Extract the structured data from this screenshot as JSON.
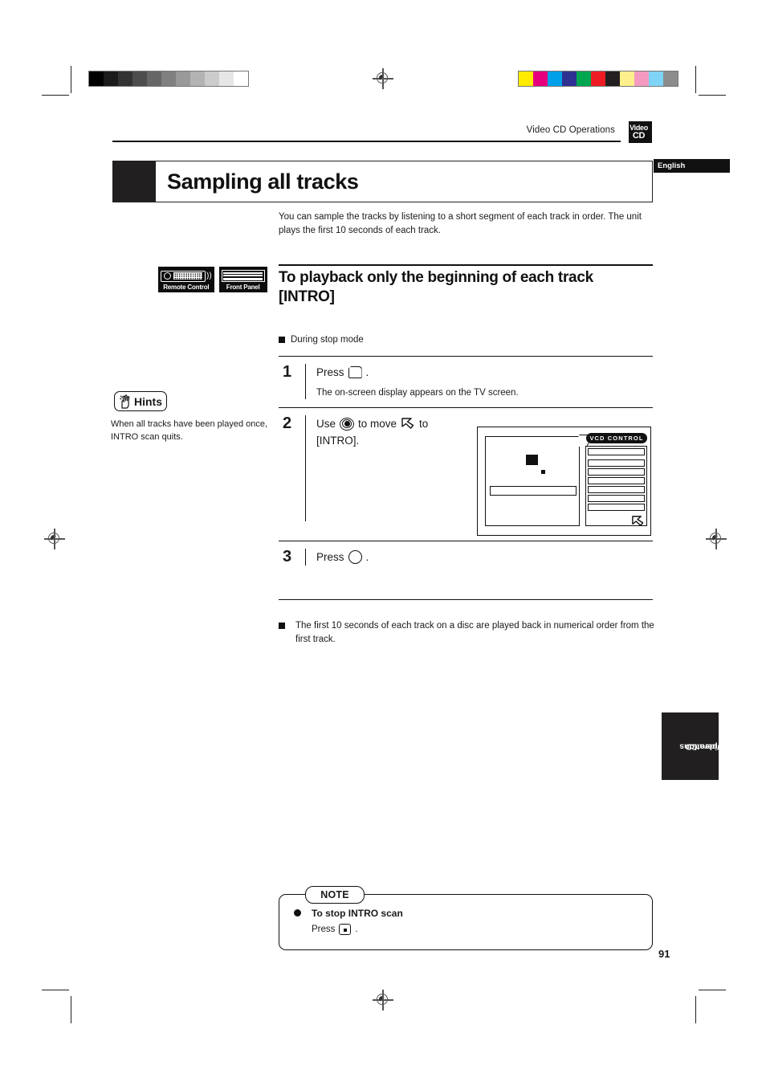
{
  "header": {
    "section_label": "Video CD Operations",
    "badge_line1": "Video",
    "badge_line2": "CD",
    "language": "English"
  },
  "title": "Sampling all tracks",
  "intro": "You can sample the tracks by listening to a short segment of each track in order. The unit plays the first 10 seconds of each track.",
  "device_badges": [
    {
      "icon": "remote-control-icon",
      "label": "Remote Control"
    },
    {
      "icon": "front-panel-icon",
      "label": "Front Panel"
    }
  ],
  "section": {
    "heading_line1": "To playback only the beginning of each track",
    "heading_line2": "[INTRO]",
    "subheading": "During stop mode"
  },
  "steps": [
    {
      "number": "1",
      "text_before": "Press",
      "key_icon": "on-screen-key-icon",
      "text_after": ".",
      "note": "The on-screen display appears on the TV screen."
    },
    {
      "number": "2",
      "text_before": "Use",
      "key_icon": "cursor-pad-icon",
      "text_middle": "to move",
      "cursor_icon": "cursor-arrow-icon",
      "text_after": "to",
      "text_line2": "[INTRO]."
    },
    {
      "number": "3",
      "text_before": "Press",
      "key_icon": "enter-key-icon",
      "text_after": "."
    }
  ],
  "tv_screen": {
    "panel_label": "VCD CONTROL",
    "menu_rows": [
      "",
      "",
      "",
      "",
      "",
      "",
      ""
    ],
    "cursor_icon": "cursor-arrow-icon"
  },
  "hints": {
    "badge_label": "Hints",
    "badge_icon": "pointing-hand-icon",
    "text": "When all tracks have been played once, INTRO scan quits."
  },
  "result_note": "The first 10 seconds of each track on a disc are played back in numerical order from the first track.",
  "note_box": {
    "caption": "NOTE",
    "bullet_title": "To stop INTRO scan",
    "bullet_text_before": "Press",
    "bullet_key_icon": "stop-key-icon",
    "bullet_text_after": "."
  },
  "side_tab": "Video CD\noperations",
  "page_number": "91",
  "print_marks": {
    "grayscale": [
      "#000000",
      "#1b1b1b",
      "#333333",
      "#4d4d4d",
      "#666666",
      "#808080",
      "#999999",
      "#b3b3b3",
      "#cccccc",
      "#e6e6e6",
      "#ffffff"
    ],
    "colors": [
      "#ffec00",
      "#e6007e",
      "#00a0e9",
      "#2e3192",
      "#00a650",
      "#ed1c24",
      "#231f20",
      "#fdf08c",
      "#f49ac1",
      "#7fd4f5",
      "#8c8c8c"
    ]
  }
}
